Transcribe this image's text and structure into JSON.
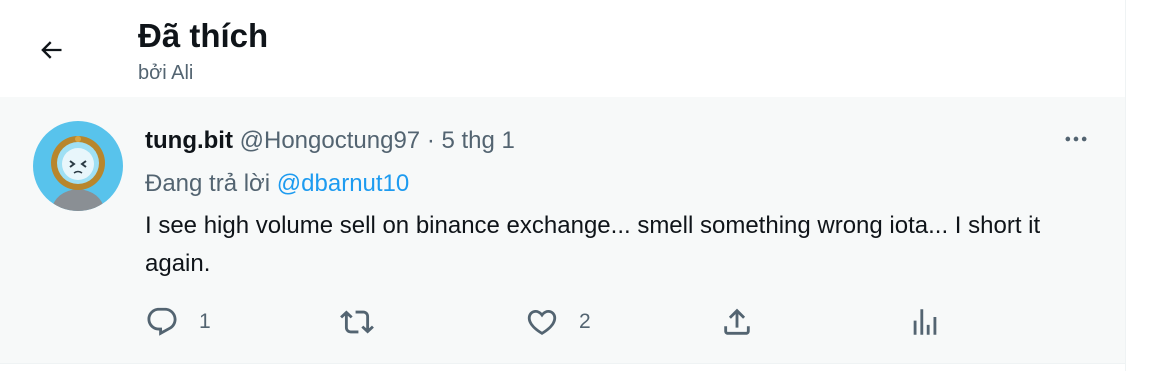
{
  "header": {
    "title": "Đã thích",
    "subtitle": "bởi Ali",
    "back_icon": "arrow-left-icon"
  },
  "tweet": {
    "display_name": "tung.bit",
    "handle": "@Hongoctung97",
    "separator": "·",
    "time": "5 thg 1",
    "reply_prefix": "Đang trả lời",
    "reply_to": "@dbarnut10",
    "text": "I see high volume sell on binance exchange... smell something wrong iota... I short it again.",
    "more_icon": "more-horizontal-icon",
    "actions": {
      "reply_count": "1",
      "retweet_count": "",
      "like_count": "2"
    }
  },
  "colors": {
    "primary_text": "#0f1419",
    "secondary_text": "#536471",
    "link": "#1d9bf0",
    "tweet_bg": "#f7f9f9"
  }
}
